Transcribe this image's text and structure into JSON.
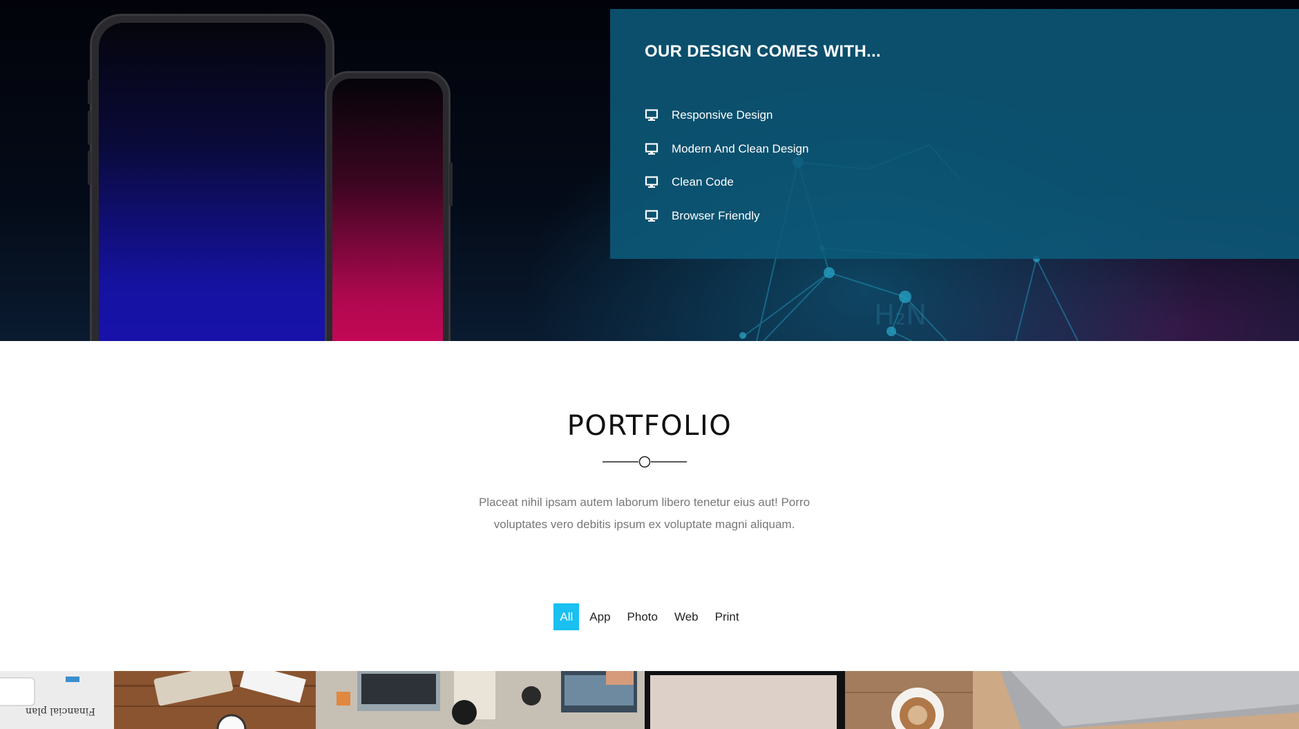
{
  "features_panel": {
    "title": "OUR DESIGN COMES WITH...",
    "items": [
      {
        "label": "Responsive Design",
        "icon": "monitor-icon"
      },
      {
        "label": "Modern And Clean Design",
        "icon": "monitor-icon"
      },
      {
        "label": "Clean Code",
        "icon": "monitor-icon"
      },
      {
        "label": "Browser Friendly",
        "icon": "monitor-icon"
      }
    ]
  },
  "portfolio": {
    "title": "PORTFOLIO",
    "description_line1": "Placeat nihil ipsam autem laborum libero tenetur eius aut! Porro",
    "description_line2": "voluptates vero debitis ipsum ex voluptate magni aliquam.",
    "filters": [
      {
        "label": "All",
        "active": true
      },
      {
        "label": "App",
        "active": false
      },
      {
        "label": "Photo",
        "active": false
      },
      {
        "label": "Web",
        "active": false
      },
      {
        "label": "Print",
        "active": false
      }
    ],
    "thumbnail_text": "Financial plan"
  },
  "colors": {
    "panel": "#0d5a7a",
    "filter_active": "#19c0f0",
    "text_muted": "#777777"
  }
}
